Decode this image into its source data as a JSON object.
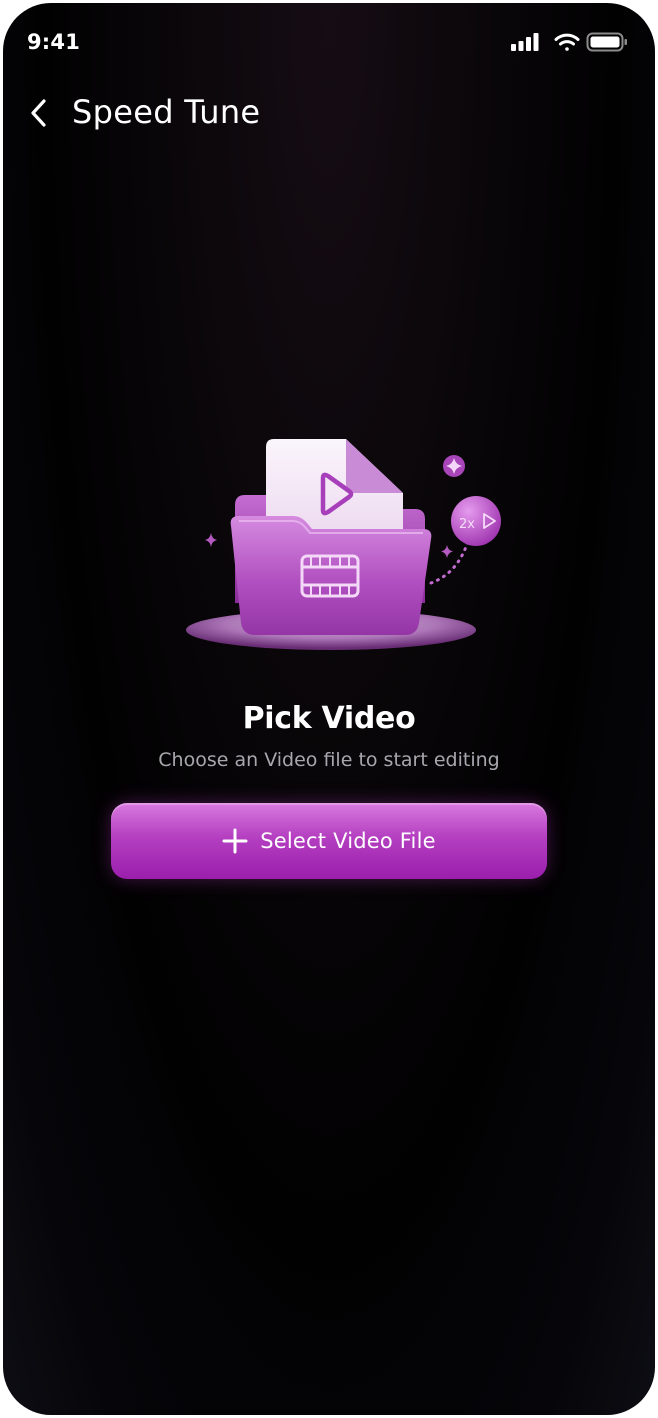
{
  "status_bar": {
    "time": "9:41",
    "icons": [
      "cellular-signal-icon",
      "wifi-icon",
      "battery-icon"
    ]
  },
  "header": {
    "back_icon": "chevron-left-icon",
    "title": "Speed Tune"
  },
  "illustration": {
    "speed_badge": "2x",
    "icons": [
      "folder-icon",
      "video-file-icon",
      "play-icon",
      "film-strip-icon",
      "sound-wave-icon",
      "sparkle-icon"
    ]
  },
  "empty_state": {
    "title": "Pick Video",
    "subtitle": "Choose an Video file to start editing"
  },
  "primary_action": {
    "icon": "plus-icon",
    "label": "Select Video File"
  },
  "colors": {
    "accent": "#b43fc0",
    "accent_light": "#d97ae0",
    "background": "#020102",
    "text_primary": "#ffffff",
    "text_secondary": "#a7a7ad"
  }
}
